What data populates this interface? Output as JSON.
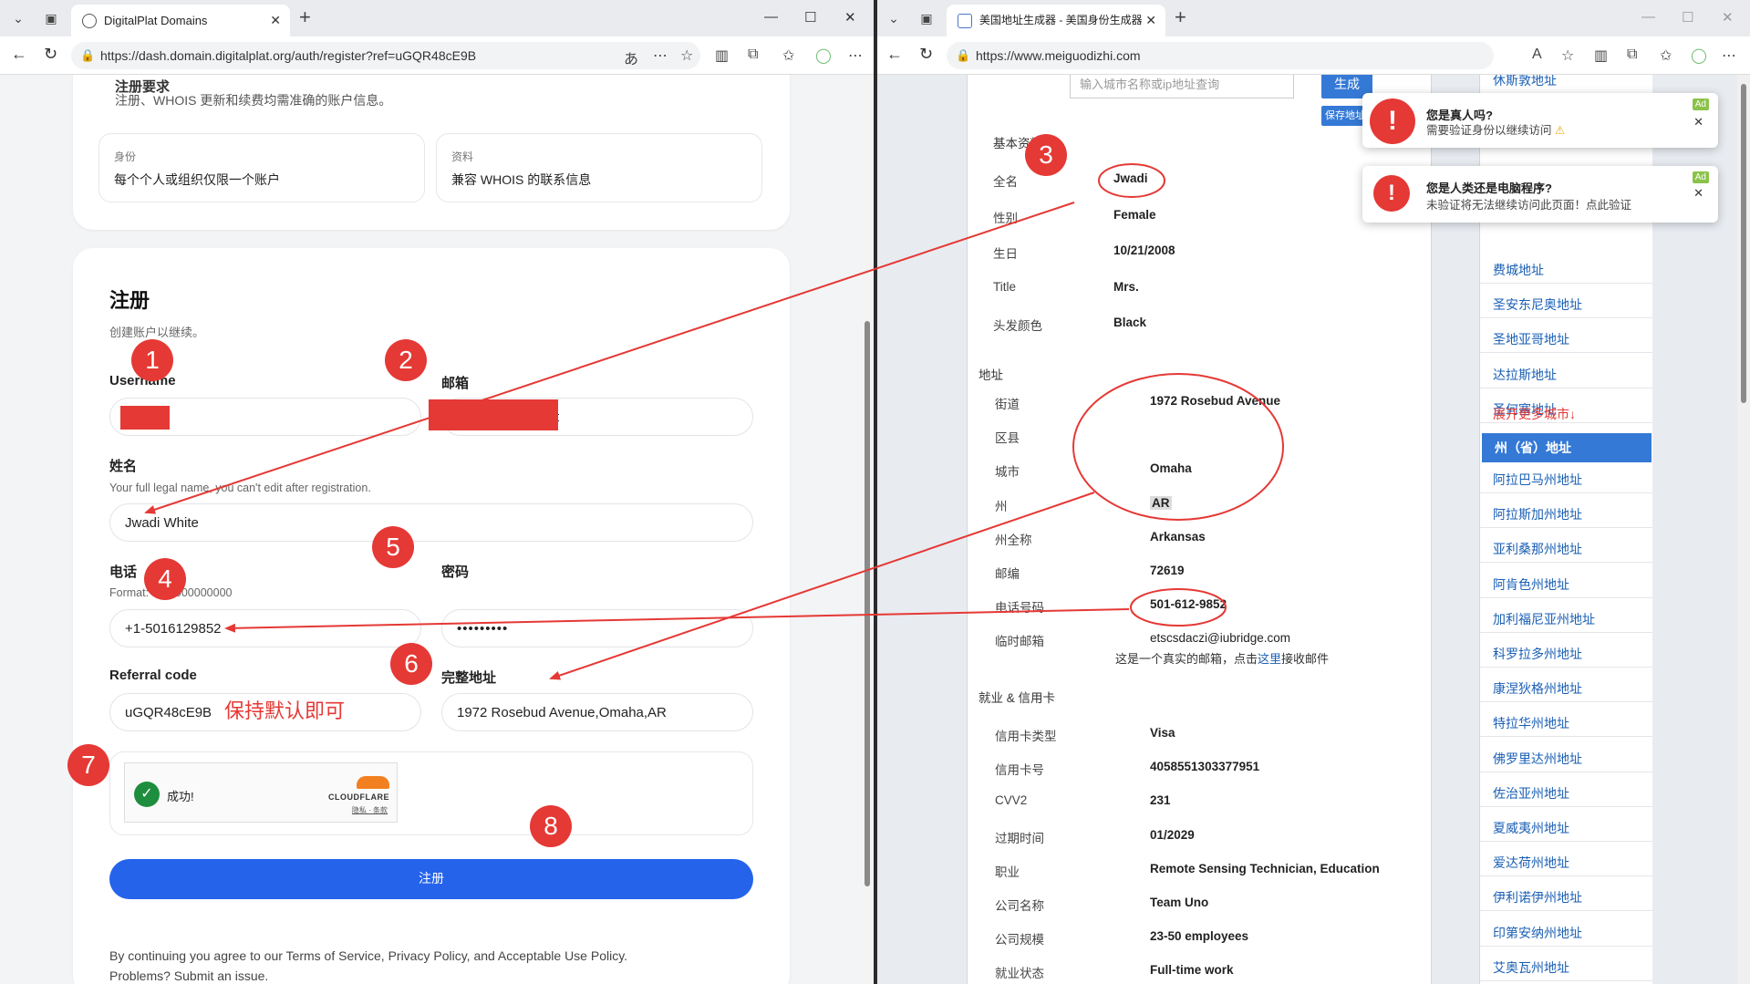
{
  "left_window": {
    "tab_title": "DigitalPlat Domains",
    "url": "https://dash.domain.digitalplat.org/auth/register?ref=uGQR48cE9B",
    "top_section": {
      "partial_heading": "注册要求",
      "desc": "注册、WHOIS 更新和续费均需准确的账户信息。",
      "card1_label": "身份",
      "card1_text": "每个个人或组织仅限一个账户",
      "card2_label": "资料",
      "card2_text": "兼容 WHOIS 的联系信息"
    },
    "form": {
      "title": "注册",
      "subtitle": "创建账户以继续。",
      "username_label": "Username",
      "email_label": "邮箱",
      "email_tail": "t",
      "name_label": "姓名",
      "name_hint": "Your full legal name, you can't edit after registration.",
      "name_value": "Jwadi White",
      "phone_label": "电话",
      "phone_hint": "Format: +1-5000000000",
      "phone_value": "+1-5016129852",
      "password_label": "密码",
      "password_value": "•••••••••",
      "referral_label": "Referral code",
      "referral_value": "uGQR48cE9B",
      "referral_note": "保持默认即可",
      "address_label": "完整地址",
      "address_value": "1972  Rosebud Avenue,Omaha,AR",
      "captcha_status": "成功!",
      "captcha_brand": "CLOUDFLARE",
      "captcha_links": "隐私 · 条款",
      "submit_label": "注册",
      "footer_text": "By continuing you agree to our Terms of Service, Privacy Policy, and Acceptable Use Policy.",
      "footer_text2": "Problems? Submit an issue."
    },
    "markers": [
      "1",
      "2",
      "3",
      "4",
      "5",
      "6",
      "7",
      "8"
    ]
  },
  "right_window": {
    "tab_title": "美国地址生成器 - 美国身份生成器",
    "url": "https://www.meiguodizhi.com",
    "search_placeholder": "输入城市名称或ip地址查询",
    "generate_label": "生成",
    "save_label": "保存地址",
    "basic_section": "基本资料",
    "basic": [
      {
        "k": "全名",
        "v": "Jwadi"
      },
      {
        "k": "性别",
        "v": "Female"
      },
      {
        "k": "生日",
        "v": "10/21/2008"
      },
      {
        "k": "Title",
        "v": "Mrs."
      },
      {
        "k": "头发颜色",
        "v": "Black"
      }
    ],
    "address_section": "地址",
    "address": [
      {
        "k": "街道",
        "v": "1972  Rosebud Avenue"
      },
      {
        "k": "区县",
        "v": ""
      },
      {
        "k": "城市",
        "v": "Omaha"
      },
      {
        "k": "州",
        "v": "AR"
      },
      {
        "k": "州全称",
        "v": "Arkansas"
      },
      {
        "k": "邮编",
        "v": "72619"
      },
      {
        "k": "电话号码",
        "v": "501-612-9852"
      },
      {
        "k": "临时邮箱",
        "v": "etscsdaczi@iubridge.com"
      }
    ],
    "email_note_pre": "这是一个真实的邮箱，点击",
    "email_note_link": "这里",
    "email_note_post": "接收邮件",
    "credit_section": "就业 & 信用卡",
    "credit": [
      {
        "k": "信用卡类型",
        "v": "Visa"
      },
      {
        "k": "信用卡号",
        "v": "4058551303377951"
      },
      {
        "k": "CVV2",
        "v": "231"
      },
      {
        "k": "过期时间",
        "v": "01/2029"
      },
      {
        "k": "职业",
        "v": "Remote Sensing Technician, Education"
      },
      {
        "k": "公司名称",
        "v": "Team Uno"
      },
      {
        "k": "公司规模",
        "v": "23-50 employees"
      },
      {
        "k": "就业状态",
        "v": "Full-time work"
      }
    ],
    "sidebar_top_partial": "休斯敦地址",
    "sidebar_cities": [
      "费城地址",
      "圣安东尼奥地址",
      "圣地亚哥地址",
      "达拉斯地址",
      "圣何塞地址"
    ],
    "sidebar_more": "展开更多城市↓",
    "sidebar_state_header": "州（省）地址",
    "sidebar_states": [
      "阿拉巴马州地址",
      "阿拉斯加州地址",
      "亚利桑那州地址",
      "阿肯色州地址",
      "加利福尼亚州地址",
      "科罗拉多州地址",
      "康涅狄格州地址",
      "特拉华州地址",
      "佛罗里达州地址",
      "佐治亚州地址",
      "夏威夷州地址",
      "爱达荷州地址",
      "伊利诺伊州地址",
      "印第安纳州地址",
      "艾奥瓦州地址"
    ],
    "popup1_title": "您是真人吗?",
    "popup1_text": "需要验证身份以继续访问",
    "popup2_title": "您是人类还是电脑程序?",
    "popup2_text": "未验证将无法继续访问此页面！点此验证",
    "ad_label": "Ad"
  },
  "annotation_color": "#e53935"
}
